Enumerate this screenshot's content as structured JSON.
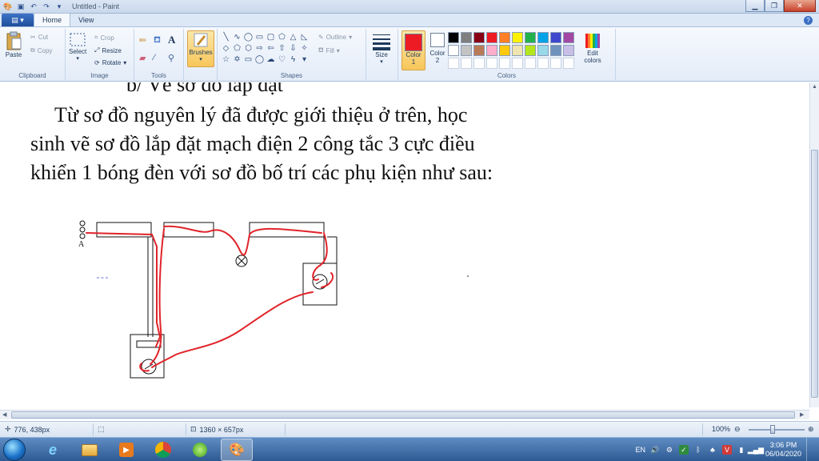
{
  "window": {
    "title": "Untitled - Paint"
  },
  "tabs": {
    "file": "▤ ▾",
    "home": "Home",
    "view": "View"
  },
  "clipboard": {
    "paste": "Paste",
    "cut": "Cut",
    "copy": "Copy",
    "label": "Clipboard"
  },
  "image": {
    "select": "Select",
    "crop": "Crop",
    "resize": "Resize",
    "rotate": "Rotate",
    "label": "Image"
  },
  "tools": {
    "label": "Tools"
  },
  "brushes": {
    "label": "Brushes"
  },
  "shapes": {
    "outline": "Outline",
    "fill": "Fill",
    "label": "Shapes"
  },
  "size": {
    "label": "Size"
  },
  "colors": {
    "color1_label": "Color",
    "color1_num": "1",
    "color2_label": "Color",
    "color2_num": "2",
    "edit_label": "Edit",
    "edit_label2": "colors",
    "label": "Colors",
    "color1": "#ed1c24",
    "color2": "#ffffff",
    "palette_row1": [
      "#000000",
      "#7f7f7f",
      "#880015",
      "#ed1c24",
      "#ff7f27",
      "#fff200",
      "#22b14c",
      "#00a2e8",
      "#3f48cc",
      "#a349a4"
    ],
    "palette_row2": [
      "#ffffff",
      "#c3c3c3",
      "#b97a57",
      "#ffaec9",
      "#ffc90e",
      "#efe4b0",
      "#b5e61d",
      "#99d9ea",
      "#7092be",
      "#c8bfe7"
    ]
  },
  "canvas": {
    "line0": "b/ Vẽ sơ đồ lắp đặt",
    "line1": "Từ sơ đồ nguyên lý đã được giới thiệu ở trên, học",
    "line2": "sinh vẽ sơ đồ lắp đặt mạch điện 2 công tắc 3 cực điều",
    "line3": "khiển 1 bóng đèn với sơ đồ bố trí các phụ kiện như sau:",
    "label_a": "A",
    "wire_color": "#e0242a"
  },
  "status": {
    "cursor_pos": "776, 438px",
    "image_size": "1360 × 657px",
    "zoom": "100%"
  },
  "taskbar": {
    "lang": "EN",
    "time": "3:06 PM",
    "date": "06/04/2020"
  }
}
